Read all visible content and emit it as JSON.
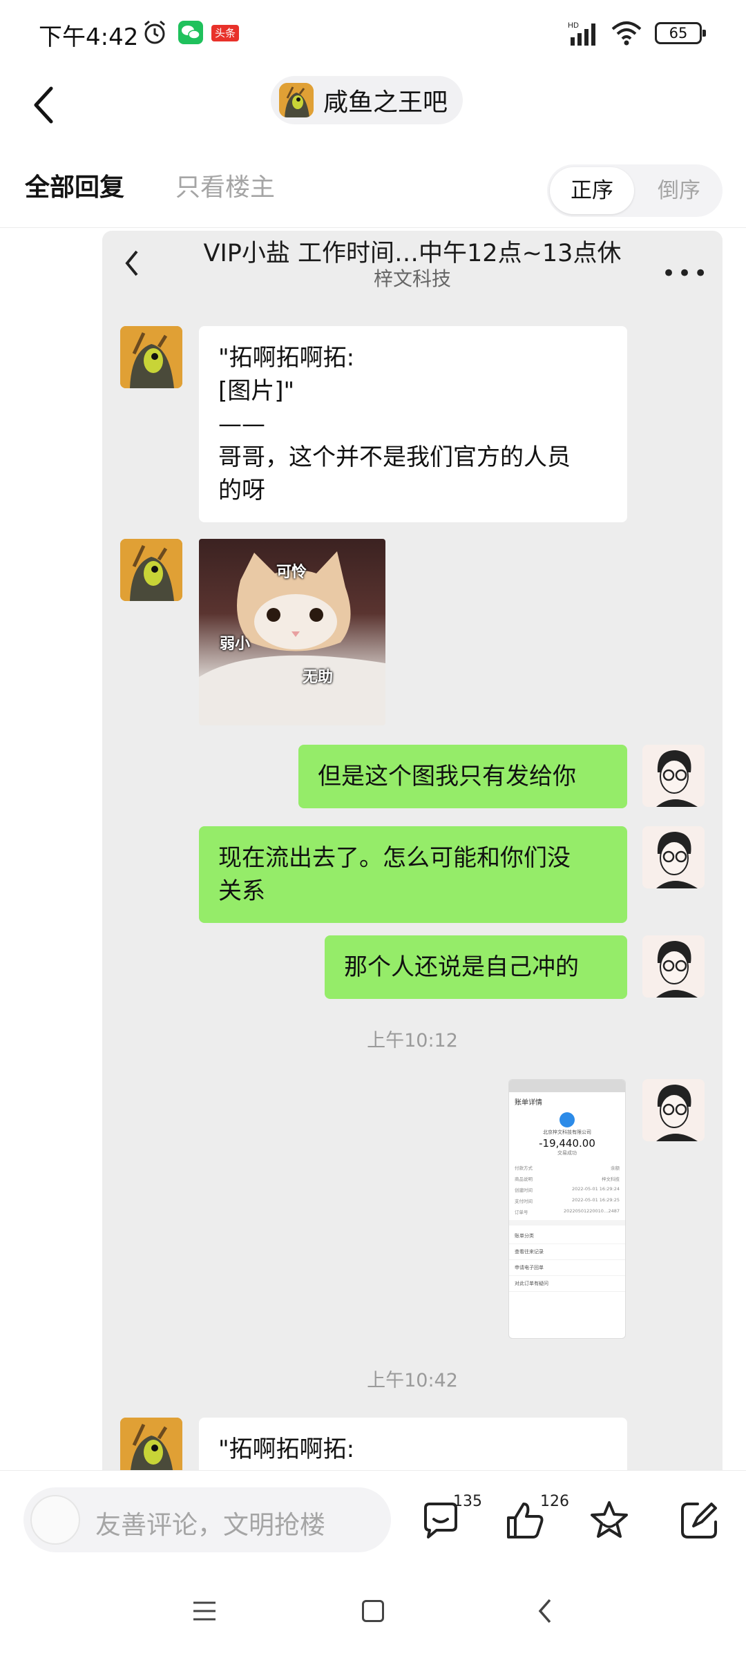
{
  "status_bar": {
    "time": "下午4:42",
    "toutiao_badge": "头条",
    "battery": "65",
    "icons": [
      "alarm-icon",
      "wechat-icon",
      "toutiao-icon",
      "hd-signal-icon",
      "wifi-icon",
      "battery-icon"
    ]
  },
  "header": {
    "back_icon": "chevron-left-icon",
    "forum_name": "咸鱼之王吧"
  },
  "tabs": {
    "all_replies": "全部回复",
    "op_only": "只看楼主",
    "sort_asc": "正序",
    "sort_desc": "倒序"
  },
  "chat_screenshot": {
    "title": "VIP小盐 工作时间…中午12点~13点休",
    "subtitle": "梓文科技",
    "messages": [
      {
        "side": "left",
        "line1": "\"拓啊拓啊拓:",
        "line2": "[图片]\"",
        "line3": "——",
        "line4": "哥哥，这个并不是我们官方的人员",
        "line5": "的呀"
      },
      {
        "side": "left",
        "type": "image",
        "labels": [
          "可怜",
          "弱小",
          "无助"
        ]
      },
      {
        "side": "right",
        "text": "但是这个图我只有发给你"
      },
      {
        "side": "right",
        "line1": "现在流出去了。怎么可能和你们没",
        "line2": "关系"
      },
      {
        "side": "right",
        "text": "那个人还说是自己冲的"
      }
    ],
    "time1": "上午10:12",
    "time2": "上午10:42",
    "last_message": "\"拓啊拓啊拓:",
    "receipt": {
      "title": "账单详情",
      "company": "北京梓文科技有限公司",
      "amount": "-19,440.00",
      "status": "交易成功",
      "rows": [
        [
          "付款方式",
          "余额"
        ],
        [
          "商品说明",
          "梓文科技"
        ],
        [
          "创建时间",
          "2022-05-01 16:29:24"
        ],
        [
          "支付时间",
          "2022-05-01 16:29:25"
        ],
        [
          "订单号",
          "20220501220010…2487"
        ]
      ],
      "links": [
        "账单分类",
        "查看往来记录",
        "申请电子回单",
        "对此订单有疑问"
      ]
    }
  },
  "bottom_bar": {
    "comment_placeholder": "友善评论，文明抢楼",
    "comment_count": "135",
    "like_count": "126"
  },
  "colors": {
    "green_bubble": "#95ec69",
    "chat_bg": "#ededed",
    "muted": "#a5a5a5"
  }
}
